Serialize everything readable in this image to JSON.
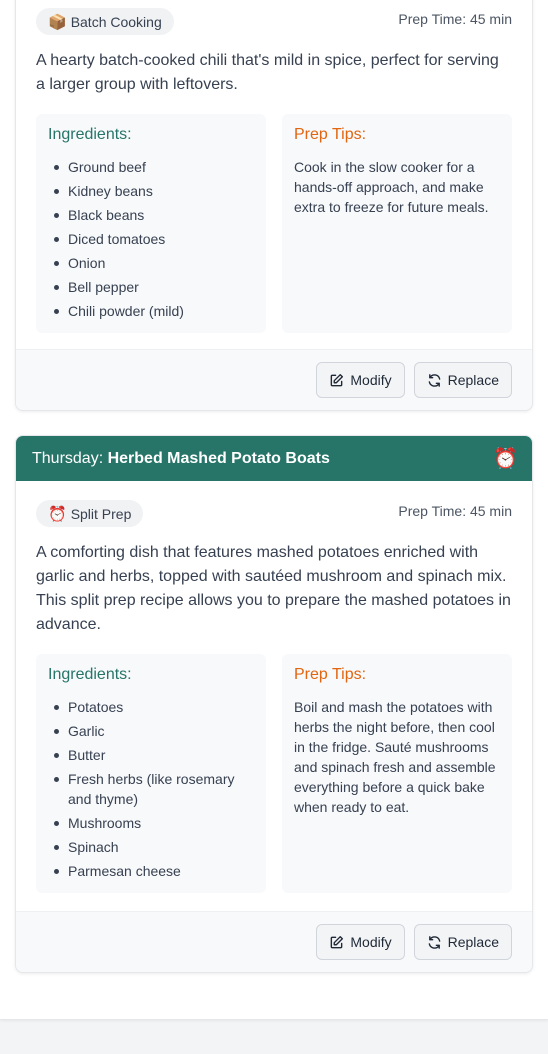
{
  "cards": [
    {
      "badge_icon": "📦",
      "badge_label": "Batch Cooking",
      "prep_time": "Prep Time: 45 min",
      "description": "A hearty batch-cooked chili that's mild in spice, perfect for serving a larger group with leftovers.",
      "ingredients_title": "Ingredients:",
      "ingredients": [
        "Ground beef",
        "Kidney beans",
        "Black beans",
        "Diced tomatoes",
        "Onion",
        "Bell pepper",
        "Chili powder (mild)"
      ],
      "tips_title": "Prep Tips:",
      "tips": "Cook in the slow cooker for a hands-off approach, and make extra to freeze for future meals.",
      "modify_label": "Modify",
      "replace_label": "Replace"
    },
    {
      "day": "Thursday:",
      "title": "Herbed Mashed Potato Boats",
      "header_icon": "⏰",
      "badge_icon": "⏰",
      "badge_label": "Split Prep",
      "prep_time": "Prep Time: 45 min",
      "description": "A comforting dish that features mashed potatoes enriched with garlic and herbs, topped with sautéed mushroom and spinach mix. This split prep recipe allows you to prepare the mashed potatoes in advance.",
      "ingredients_title": "Ingredients:",
      "ingredients": [
        "Potatoes",
        "Garlic",
        "Butter",
        "Fresh herbs (like rosemary and thyme)",
        "Mushrooms",
        "Spinach",
        "Parmesan cheese"
      ],
      "tips_title": "Prep Tips:",
      "tips": "Boil and mash the potatoes with herbs the night before, then cool in the fridge. Sauté mushrooms and spinach fresh and assemble everything before a quick bake when ready to eat.",
      "modify_label": "Modify",
      "replace_label": "Replace"
    }
  ],
  "colors": {
    "header_bg": "#267568",
    "ingredients_title": "#267568",
    "tips_title": "#e2650f"
  }
}
